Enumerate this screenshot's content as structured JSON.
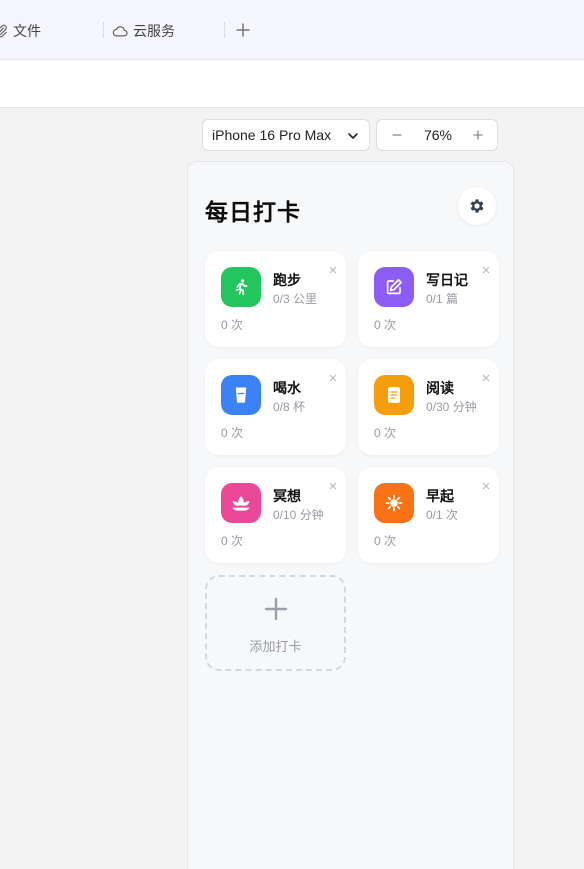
{
  "browser": {
    "tabs": [
      {
        "label": "文件",
        "icon": "paperclip-icon"
      },
      {
        "label": "云服务",
        "icon": "cloud-icon"
      }
    ]
  },
  "device_bar": {
    "device": "iPhone 16 Pro Max",
    "zoom": "76%"
  },
  "app": {
    "title": "每日打卡",
    "add_label": "添加打卡",
    "habits": [
      {
        "name": "跑步",
        "progress": "0/3 公里",
        "count": "0 次",
        "icon": "running-icon",
        "color": "#22c55e"
      },
      {
        "name": "写日记",
        "progress": "0/1 篇",
        "count": "0 次",
        "icon": "edit-icon",
        "color": "#8b5cf6"
      },
      {
        "name": "喝水",
        "progress": "0/8 杯",
        "count": "0 次",
        "icon": "cup-icon",
        "color": "#3b82f6"
      },
      {
        "name": "阅读",
        "progress": "0/30 分钟",
        "count": "0 次",
        "icon": "book-icon",
        "color": "#f59e0b"
      },
      {
        "name": "冥想",
        "progress": "0/10 分钟",
        "count": "0 次",
        "icon": "lotus-icon",
        "color": "#ec4899"
      },
      {
        "name": "早起",
        "progress": "0/1 次",
        "count": "0 次",
        "icon": "sun-icon",
        "color": "#f97316"
      }
    ]
  }
}
